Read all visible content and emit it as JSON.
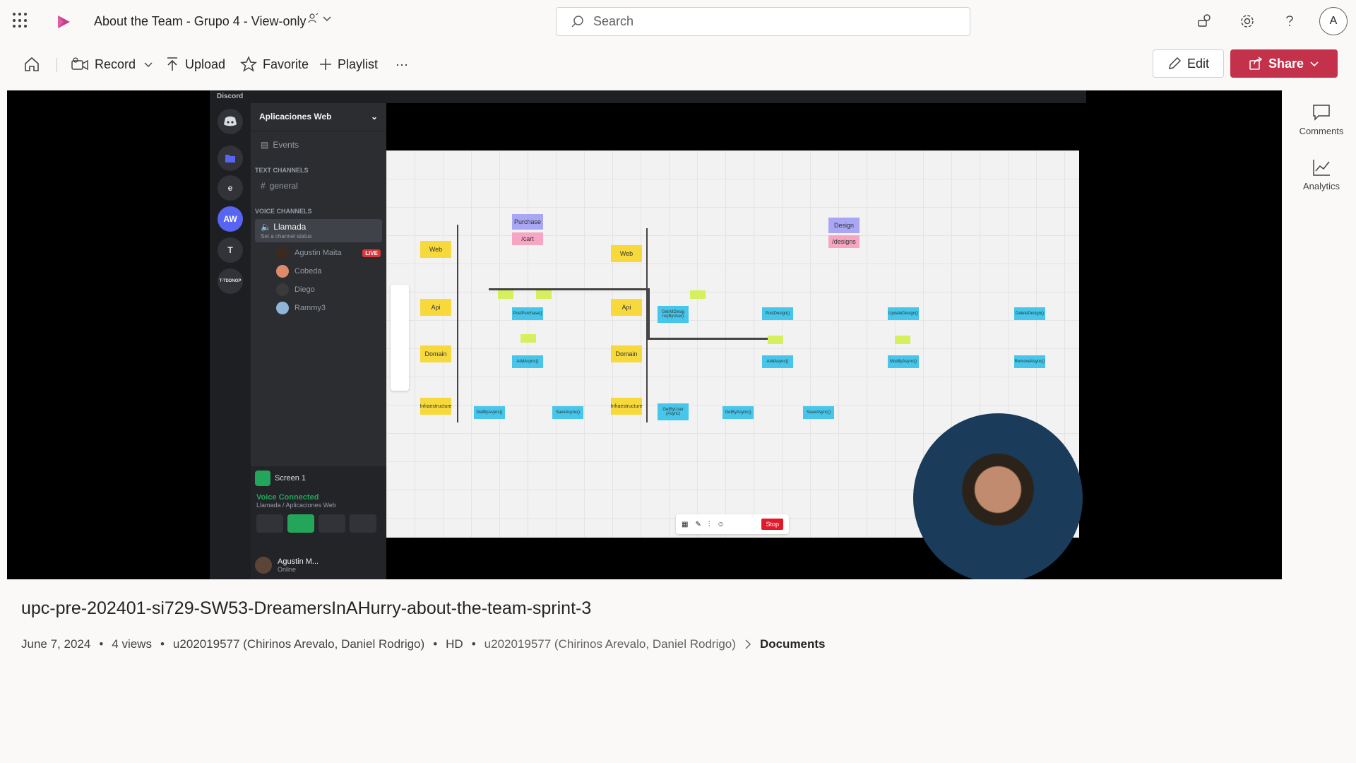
{
  "header": {
    "doc_title": "About the Team - Grupo 4 - View-only",
    "search_placeholder": "Search",
    "avatar_initial": "A",
    "brand_color": "#c4314b"
  },
  "toolbar": {
    "record": "Record",
    "upload": "Upload",
    "favorite": "Favorite",
    "playlist": "Playlist",
    "more": "···",
    "edit": "Edit",
    "share": "Share"
  },
  "side_panel": {
    "comments": "Comments",
    "analytics": "Analytics"
  },
  "discord": {
    "app_name": "Discord",
    "server_name": "Aplicaciones Web",
    "events": "Events",
    "text_channels": "TEXT CHANNELS",
    "general": "general",
    "voice_channels": "VOICE CHANNELS",
    "voice_channel": "Llamada",
    "channel_status": "Set a channel status",
    "guilds": [
      "e",
      "AW",
      "T",
      "T-TDDNOP"
    ],
    "voice_users": [
      {
        "name": "Agustin Maita",
        "badge": "LIVE"
      },
      {
        "name": "Cobeda"
      },
      {
        "name": "Diego"
      },
      {
        "name": "Rammy3"
      }
    ],
    "screen": "Screen 1",
    "voice_connected": "Voice Connected",
    "voice_location": "Llamada / Aplicaciones Web",
    "me_name": "Agustin M...",
    "me_status": "Online"
  },
  "miro": {
    "stop": "Stop",
    "layers_left": [
      "Web",
      "Api",
      "Domain",
      "Infraestructure"
    ],
    "layers_right": [
      "Web",
      "Api",
      "Domain",
      "Infraestructure"
    ],
    "purchase": "Purchase",
    "cart": "/cart",
    "design": "Design",
    "designs": "/designs",
    "methods": [
      "PostPurchase()",
      "AddAsync()",
      "SaveAsync()",
      "GetByAsync()",
      "GetAllDesig ns(ByUser)",
      "PostDesign()",
      "AddAsync()",
      "SaveAsync()",
      "GetByAsync()",
      "UpdateDesign()",
      "ModifyAsync()",
      "DeleteDesign()",
      "RemoveAsync()",
      "GetByUser (Async)"
    ]
  },
  "video": {
    "title": "upc-pre-202401-si729-SW53-DreamersInAHurry-about-the-team-sprint-3",
    "date": "June 7, 2024",
    "views": "4 views",
    "owner": "u202019577 (Chirinos Arevalo, Daniel Rodrigo)",
    "quality": "HD",
    "location_owner": "u202019577 (Chirinos Arevalo, Daniel Rodrigo)",
    "location_folder": "Documents"
  }
}
